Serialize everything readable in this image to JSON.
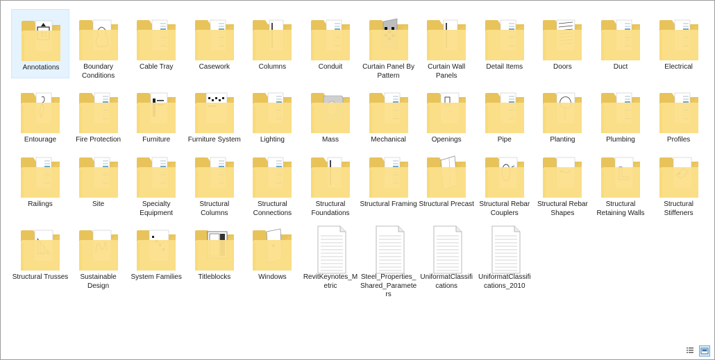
{
  "items": [
    {
      "label": "Annotations",
      "kind": "folder",
      "preview": "annotation",
      "selected": true
    },
    {
      "label": "Boundary Conditions",
      "kind": "folder",
      "preview": "shape"
    },
    {
      "label": "Cable Tray",
      "kind": "folder",
      "preview": "doc"
    },
    {
      "label": "Casework",
      "kind": "folder",
      "preview": "doc"
    },
    {
      "label": "Columns",
      "kind": "folder",
      "preview": "tall-sheet"
    },
    {
      "label": "Conduit",
      "kind": "folder",
      "preview": "doc"
    },
    {
      "label": "Curtain Panel By Pattern",
      "kind": "folder",
      "preview": "panel"
    },
    {
      "label": "Curtain Wall Panels",
      "kind": "folder",
      "preview": "tall-sheet"
    },
    {
      "label": "Detail Items",
      "kind": "folder",
      "preview": "doc"
    },
    {
      "label": "Doors",
      "kind": "folder",
      "preview": "lines"
    },
    {
      "label": "Duct",
      "kind": "folder",
      "preview": "doc"
    },
    {
      "label": "Electrical",
      "kind": "folder",
      "preview": "doc"
    },
    {
      "label": "Entourage",
      "kind": "folder",
      "preview": "person"
    },
    {
      "label": "Fire Protection",
      "kind": "folder",
      "preview": "doc"
    },
    {
      "label": "Furniture",
      "kind": "folder",
      "preview": "furniture"
    },
    {
      "label": "Furniture System",
      "kind": "folder",
      "preview": "furniture-sys"
    },
    {
      "label": "Lighting",
      "kind": "folder",
      "preview": "doc"
    },
    {
      "label": "Mass",
      "kind": "folder",
      "preview": "mass"
    },
    {
      "label": "Mechanical",
      "kind": "folder",
      "preview": "doc"
    },
    {
      "label": "Openings",
      "kind": "folder",
      "preview": "opening"
    },
    {
      "label": "Pipe",
      "kind": "folder",
      "preview": "doc"
    },
    {
      "label": "Planting",
      "kind": "folder",
      "preview": "tree"
    },
    {
      "label": "Plumbing",
      "kind": "folder",
      "preview": "doc"
    },
    {
      "label": "Profiles",
      "kind": "folder",
      "preview": "doc"
    },
    {
      "label": "Railings",
      "kind": "folder",
      "preview": "doc"
    },
    {
      "label": "Site",
      "kind": "folder",
      "preview": "doc"
    },
    {
      "label": "Specialty Equipment",
      "kind": "folder",
      "preview": "doc"
    },
    {
      "label": "Structural Columns",
      "kind": "folder",
      "preview": "doc"
    },
    {
      "label": "Structural Connections",
      "kind": "folder",
      "preview": "doc"
    },
    {
      "label": "Structural Foundations",
      "kind": "folder",
      "preview": "tall-sheet"
    },
    {
      "label": "Structural Framing",
      "kind": "folder",
      "preview": "doc"
    },
    {
      "label": "Structural Precast",
      "kind": "folder",
      "preview": "precast"
    },
    {
      "label": "Structural Rebar Couplers",
      "kind": "folder",
      "preview": "coupler"
    },
    {
      "label": "Structural Rebar Shapes",
      "kind": "folder",
      "preview": "rebar"
    },
    {
      "label": "Structural Retaining Walls",
      "kind": "folder",
      "preview": "wall"
    },
    {
      "label": "Structural Stiffeners",
      "kind": "folder",
      "preview": "stiffener"
    },
    {
      "label": "Structural Trusses",
      "kind": "folder",
      "preview": "truss"
    },
    {
      "label": "Sustainable Design",
      "kind": "folder",
      "preview": "wave"
    },
    {
      "label": "System Families",
      "kind": "folder",
      "preview": "sysfam"
    },
    {
      "label": "Titleblocks",
      "kind": "folder",
      "preview": "titleblock"
    },
    {
      "label": "Windows",
      "kind": "folder",
      "preview": "window"
    },
    {
      "label": "RevitKeynotes_Metric",
      "label_lines": [
        "RevitKeynotes_M",
        "etric"
      ],
      "kind": "file"
    },
    {
      "label": "Steel_Properties_Shared_Parameters",
      "label_lines": [
        "Steel_Properties_",
        "Shared_Paramete",
        "rs"
      ],
      "kind": "file"
    },
    {
      "label": "UniformatClassifications",
      "label_lines": [
        "UniformatClassifi",
        "cations"
      ],
      "kind": "file"
    },
    {
      "label": "UniformatClassifications_2010",
      "label_lines": [
        "UniformatClassifi",
        "cations_2010"
      ],
      "kind": "file"
    }
  ],
  "view_buttons": {
    "details": "details-view-icon",
    "large_icons": "large-icons-view-icon",
    "active": "large_icons"
  },
  "colors": {
    "folder_back": "#e7c35a",
    "folder_front": "#fbe08b",
    "folder_shade": "#f1d072",
    "selection_bg": "#e5f3ff",
    "selection_border": "#cce8ff"
  }
}
